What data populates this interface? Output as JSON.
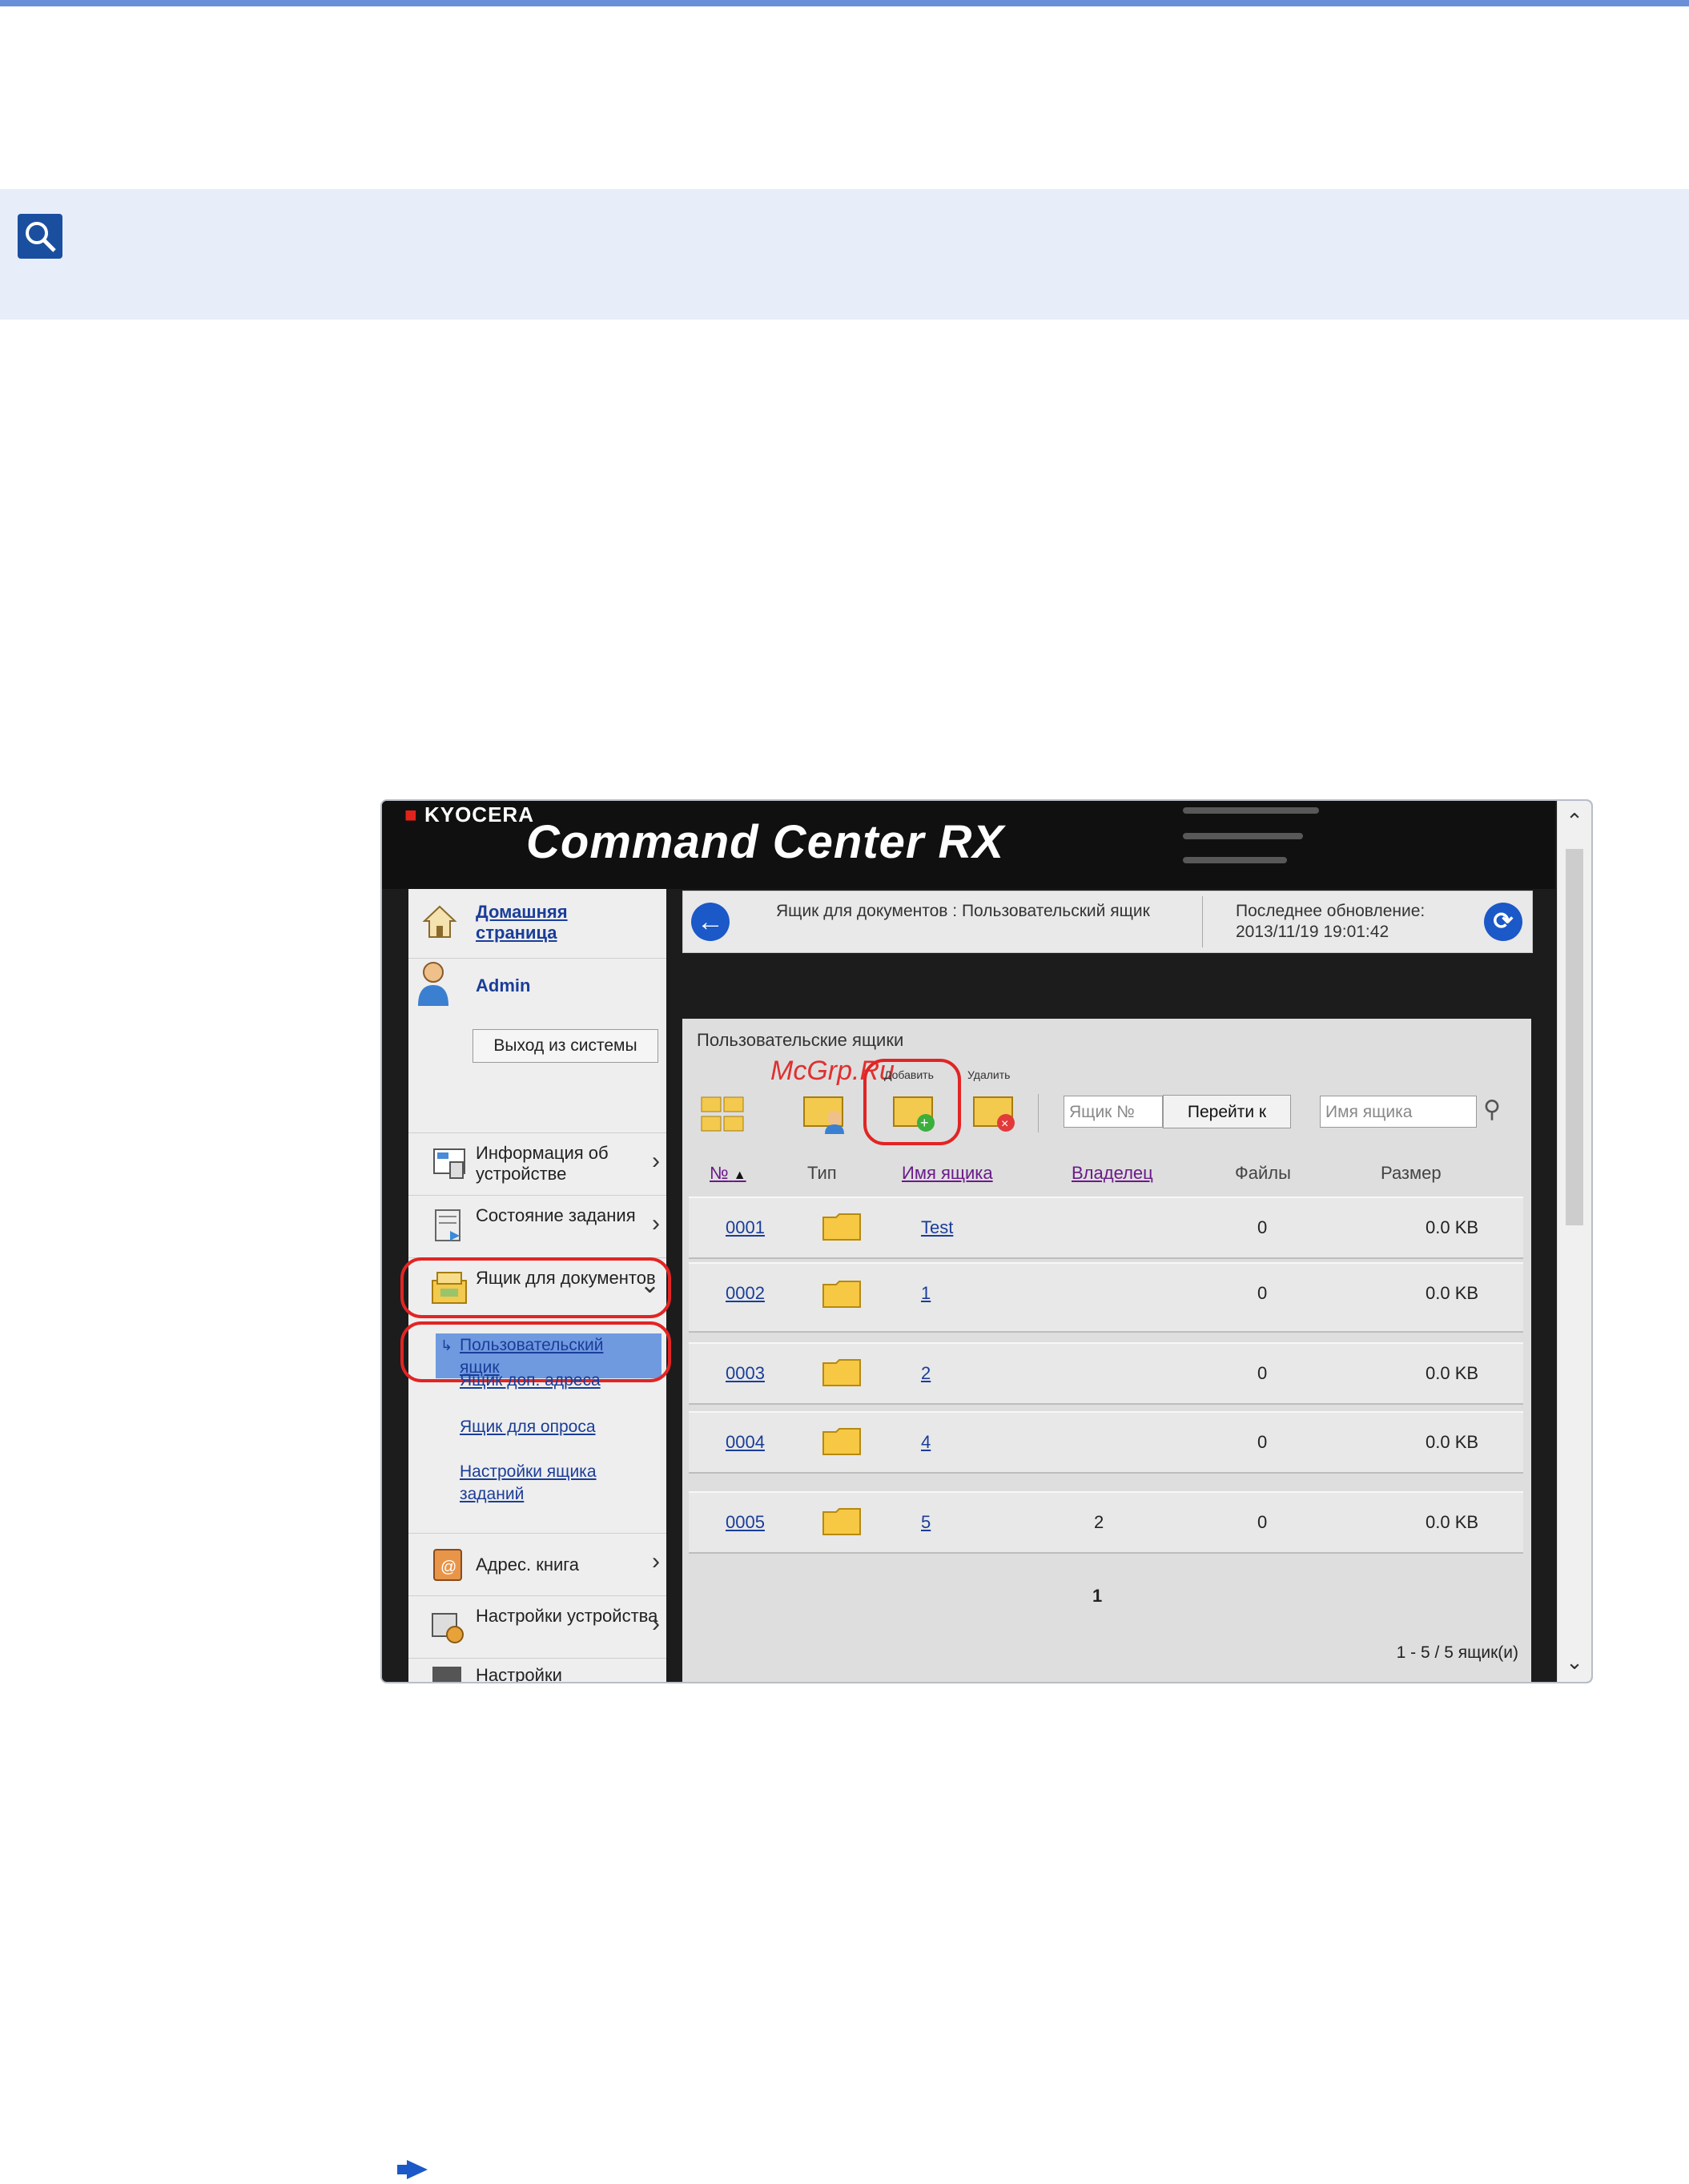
{
  "page": {
    "accent": "#1b58c8",
    "topbar_color": "#6a8fd8",
    "note_bg": "#e8edfa"
  },
  "icons": {
    "note": "tip-magnifier-icon",
    "bottom": "arrow-right-icon"
  },
  "app": {
    "brand": "KYOCERA",
    "title": "Command Center RX"
  },
  "sidebar": {
    "home": "Домашняя страница",
    "user": "Admin",
    "logout": "Выход из системы",
    "items": [
      {
        "label": "Информация об устройстве",
        "icon": "device-info-icon"
      },
      {
        "label": "Состояние задания",
        "icon": "job-status-icon"
      },
      {
        "label": "Ящик для документов",
        "icon": "document-box-icon",
        "expanded": true
      },
      {
        "label": "Адрес. книга",
        "icon": "address-book-icon"
      },
      {
        "label": "Настройки устройства",
        "icon": "device-settings-icon"
      },
      {
        "label": "Настройки",
        "icon": "settings-icon"
      }
    ],
    "subitems": [
      {
        "label": "Пользовательский ящик",
        "active": true
      },
      {
        "label": "Ящик доп. адреса"
      },
      {
        "label": "Ящик для опроса"
      },
      {
        "label": "Настройки ящика заданий"
      }
    ]
  },
  "breadcrumb": {
    "text": "Ящик для документов : Пользовательский ящик",
    "update_label": "Последнее обновление:",
    "update_time": "2013/11/19 19:01:42"
  },
  "panel": {
    "title": "Пользовательские ящики",
    "add_label": "Добавить",
    "delete_label": "Удалить",
    "box_no_placeholder": "Ящик №",
    "goto_label": "Перейти к",
    "box_name_placeholder": "Имя ящика",
    "watermark": "McGrp.Ru"
  },
  "table": {
    "headers": [
      "№",
      "Тип",
      "Имя ящика",
      "Владелец",
      "Файлы",
      "Размер"
    ],
    "rows": [
      {
        "no": "0001",
        "name": "Test",
        "owner": "",
        "files": "0",
        "size": "0.0 KB"
      },
      {
        "no": "0002",
        "name": "1",
        "owner": "",
        "files": "0",
        "size": "0.0 KB"
      },
      {
        "no": "0003",
        "name": "2",
        "owner": "",
        "files": "0",
        "size": "0.0 KB"
      },
      {
        "no": "0004",
        "name": "4",
        "owner": "",
        "files": "0",
        "size": "0.0 KB"
      },
      {
        "no": "0005",
        "name": "5",
        "owner": "2",
        "files": "0",
        "size": "0.0 KB"
      }
    ],
    "page": "1",
    "count": "1 - 5 / 5 ящик(и)"
  }
}
